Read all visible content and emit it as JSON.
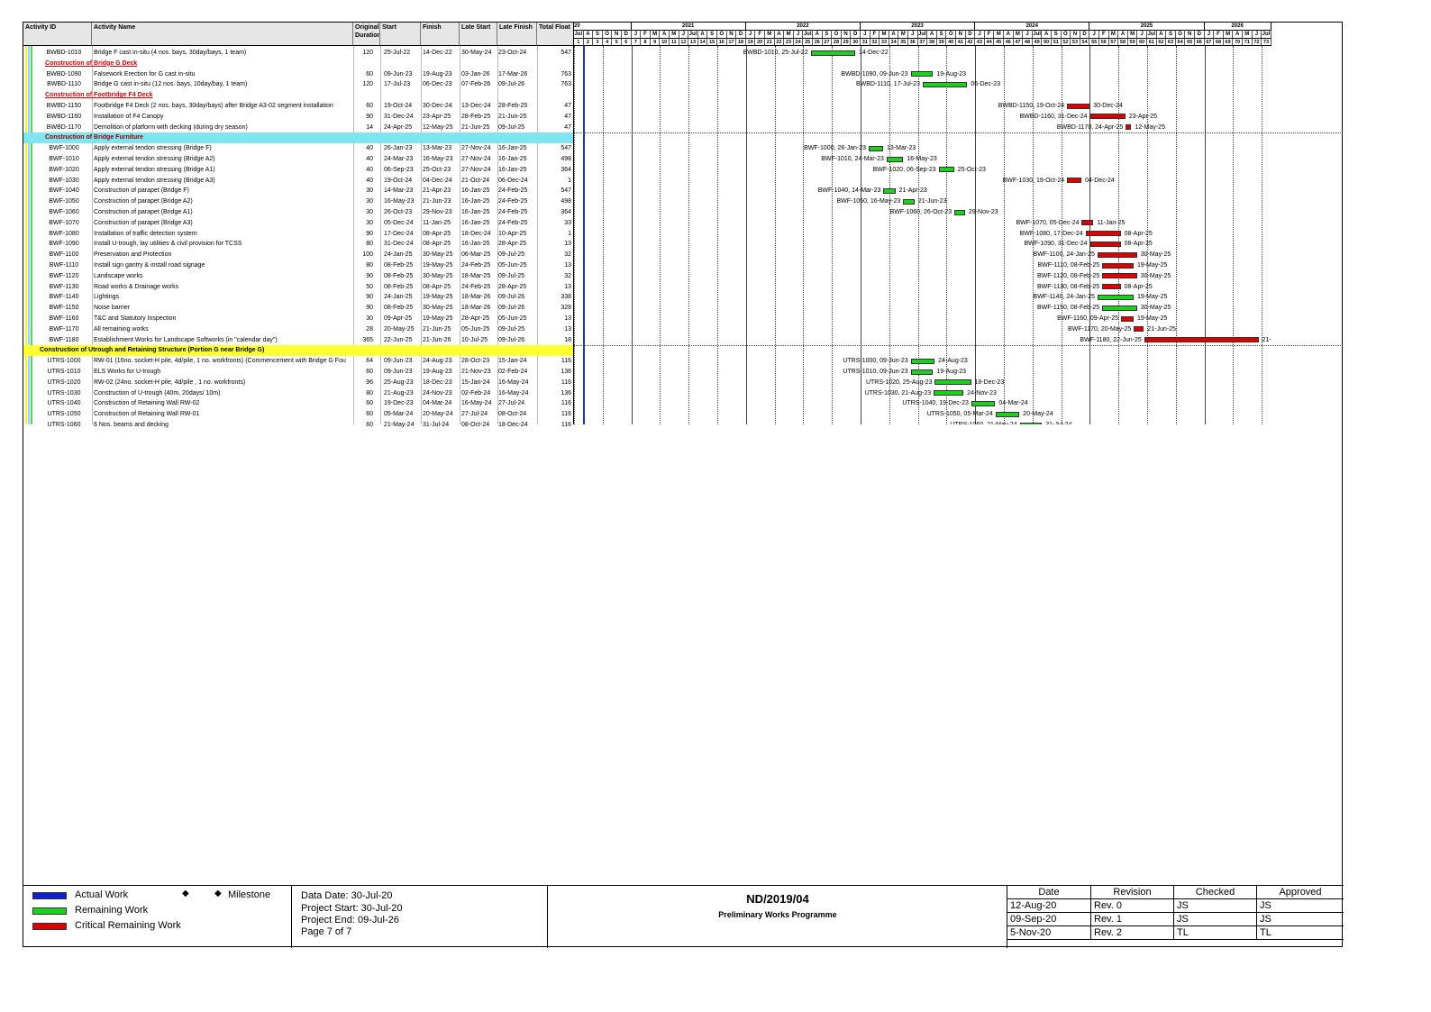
{
  "columns": {
    "id": "Activity ID",
    "name": "Activity Name",
    "duration": "Original Duration",
    "start": "Start",
    "finish": "Finish",
    "late_start": "Late Start",
    "late_finish": "Late Finish",
    "total_float": "Total Float"
  },
  "rows": [
    {
      "type": "act",
      "id": "BWBD-1010",
      "name": "Bridge F cast in-situ (4 nos. bays, 30day/bays, 1 team)",
      "dur": "120",
      "start": "25-Jul-22",
      "finish": "14-Dec-22",
      "ls": "30-May-24",
      "lf": "23-Oct-24",
      "tf": "547",
      "crit": false,
      "bar_label": "BWBD-1010, 25-Jul-22"
    },
    {
      "type": "wbs",
      "style": "red",
      "name": "Construction of Bridge G Deck"
    },
    {
      "type": "act",
      "id": "BWBD-1090",
      "name": "Falsework Erection for G cast in-situ",
      "dur": "60",
      "start": "09-Jun-23",
      "finish": "19-Aug-23",
      "ls": "03-Jan-26",
      "lf": "17-Mar-26",
      "tf": "763",
      "crit": false,
      "bar_label": "BWBD-1090, 09-Jun-23"
    },
    {
      "type": "act",
      "id": "BWBD-1110",
      "name": "Bridge G cast in-situ (12 nos. bays, 10day/bay, 1 team)",
      "dur": "120",
      "start": "17-Jul-23",
      "finish": "06-Dec-23",
      "ls": "07-Feb-26",
      "lf": "09-Jul-26",
      "tf": "763",
      "crit": false,
      "bar_label": "BWBD-1110, 17-Jul-23"
    },
    {
      "type": "wbs",
      "style": "red",
      "name": "Construction of Footbridge F4 Deck"
    },
    {
      "type": "act",
      "id": "BWBD-1150",
      "name": "Footbridge F4 Deck (2 nos. bays, 30day/bays) after Bridge A3-02 segment installation",
      "dur": "60",
      "start": "19-Oct-24",
      "finish": "30-Dec-24",
      "ls": "13-Dec-24",
      "lf": "28-Feb-25",
      "tf": "47",
      "crit": true,
      "bar_label": "BWBD-1150, 19-Oct-24"
    },
    {
      "type": "act",
      "id": "BWBD-1160",
      "name": "Installation of F4 Canopy",
      "dur": "90",
      "start": "31-Dec-24",
      "finish": "23-Apr-25",
      "ls": "28-Feb-25",
      "lf": "21-Jun-25",
      "tf": "47",
      "crit": true,
      "bar_label": "BWBD-1160, 31-Dec-24"
    },
    {
      "type": "act",
      "id": "BWBD-1170",
      "name": "Demolition of platform with decking (during dry season)",
      "dur": "14",
      "start": "24-Apr-25",
      "finish": "12-May-25",
      "ls": "21-Jun-25",
      "lf": "09-Jul-25",
      "tf": "47",
      "crit": true,
      "bar_label": "BWBD-1170, 24-Apr-25"
    },
    {
      "type": "wbs",
      "style": "cyan",
      "name": "Construction of Bridge Furniture"
    },
    {
      "type": "act",
      "id": "BWF-1000",
      "name": "Apply external tendon stressing (Bridge F)",
      "dur": "40",
      "start": "26-Jan-23",
      "finish": "13-Mar-23",
      "ls": "27-Nov-24",
      "lf": "16-Jan-25",
      "tf": "547",
      "crit": false,
      "bar_label": "BWF-1000, 26-Jan-23"
    },
    {
      "type": "act",
      "id": "BWF-1010",
      "name": "Apply external tendon stressing (Bridge A2)",
      "dur": "40",
      "start": "24-Mar-23",
      "finish": "16-May-23",
      "ls": "27-Nov-24",
      "lf": "16-Jan-25",
      "tf": "498",
      "crit": false,
      "bar_label": "BWF-1010, 24-Mar-23"
    },
    {
      "type": "act",
      "id": "BWF-1020",
      "name": "Apply external tendon stressing (Bridge A1)",
      "dur": "40",
      "start": "06-Sep-23",
      "finish": "25-Oct-23",
      "ls": "27-Nov-24",
      "lf": "16-Jan-25",
      "tf": "364",
      "crit": false,
      "bar_label": "BWF-1020, 06-Sep-23"
    },
    {
      "type": "act",
      "id": "BWF-1030",
      "name": "Apply external tendon stressing (Bridge A3)",
      "dur": "40",
      "start": "19-Oct-24",
      "finish": "04-Dec-24",
      "ls": "21-Oct-24",
      "lf": "06-Dec-24",
      "tf": "1",
      "crit": true,
      "bar_label": "BWF-1030, 19-Oct-24"
    },
    {
      "type": "act",
      "id": "BWF-1040",
      "name": "Construction of parapet  (Bridge F)",
      "dur": "30",
      "start": "14-Mar-23",
      "finish": "21-Apr-23",
      "ls": "16-Jan-25",
      "lf": "24-Feb-25",
      "tf": "547",
      "crit": false,
      "bar_label": "BWF-1040, 14-Mar-23"
    },
    {
      "type": "act",
      "id": "BWF-1050",
      "name": "Construction of parapet (Bridge A2)",
      "dur": "30",
      "start": "16-May-23",
      "finish": "21-Jun-23",
      "ls": "16-Jan-25",
      "lf": "24-Feb-25",
      "tf": "498",
      "crit": false,
      "bar_label": "BWF-1050, 16-May-23"
    },
    {
      "type": "act",
      "id": "BWF-1060",
      "name": "Construction of parapet (Bridge A1)",
      "dur": "30",
      "start": "26-Oct-23",
      "finish": "29-Nov-23",
      "ls": "16-Jan-25",
      "lf": "24-Feb-25",
      "tf": "364",
      "crit": false,
      "bar_label": "BWF-1060, 26-Oct-23"
    },
    {
      "type": "act",
      "id": "BWF-1070",
      "name": "Construction of parapet (Bridge A3)",
      "dur": "30",
      "start": "05-Dec-24",
      "finish": "11-Jan-25",
      "ls": "16-Jan-25",
      "lf": "24-Feb-25",
      "tf": "33",
      "crit": true,
      "bar_label": "BWF-1070, 05-Dec-24"
    },
    {
      "type": "act",
      "id": "BWF-1080",
      "name": "Installation of traffic detection system",
      "dur": "90",
      "start": "17-Dec-24",
      "finish": "08-Apr-25",
      "ls": "18-Dec-24",
      "lf": "10-Apr-25",
      "tf": "1",
      "crit": true,
      "bar_label": "BWF-1080, 17-Dec-24"
    },
    {
      "type": "act",
      "id": "BWF-1090",
      "name": "Install U-trough, lay utilities & civil provision for TCSS",
      "dur": "80",
      "start": "31-Dec-24",
      "finish": "08-Apr-25",
      "ls": "16-Jan-25",
      "lf": "28-Apr-25",
      "tf": "13",
      "crit": true,
      "bar_label": "BWF-1090, 31-Dec-24"
    },
    {
      "type": "act",
      "id": "BWF-1100",
      "name": "Preservation and Protection",
      "dur": "100",
      "start": "24-Jan-25",
      "finish": "30-May-25",
      "ls": "06-Mar-25",
      "lf": "09-Jul-25",
      "tf": "32",
      "crit": true,
      "bar_label": "BWF-1100, 24-Jan-25"
    },
    {
      "type": "act",
      "id": "BWF-1110",
      "name": "Install sign gantry & install road signage",
      "dur": "80",
      "start": "08-Feb-25",
      "finish": "19-May-25",
      "ls": "24-Feb-25",
      "lf": "05-Jun-25",
      "tf": "13",
      "crit": true,
      "bar_label": "BWF-1110, 08-Feb-25"
    },
    {
      "type": "act",
      "id": "BWF-1120",
      "name": "Landscape works",
      "dur": "90",
      "start": "08-Feb-25",
      "finish": "30-May-25",
      "ls": "18-Mar-25",
      "lf": "09-Jul-25",
      "tf": "32",
      "crit": true,
      "bar_label": "BWF-1120, 08-Feb-25"
    },
    {
      "type": "act",
      "id": "BWF-1130",
      "name": "Road works & Drainage works",
      "dur": "50",
      "start": "08-Feb-25",
      "finish": "08-Apr-25",
      "ls": "24-Feb-25",
      "lf": "28-Apr-25",
      "tf": "13",
      "crit": true,
      "bar_label": "BWF-1130, 08-Feb-25"
    },
    {
      "type": "act",
      "id": "BWF-1140",
      "name": "Lightings",
      "dur": "90",
      "start": "24-Jan-25",
      "finish": "19-May-25",
      "ls": "18-Mar-26",
      "lf": "09-Jul-26",
      "tf": "338",
      "crit": false,
      "bar_label": "BWF-1140, 24-Jan-25"
    },
    {
      "type": "act",
      "id": "BWF-1150",
      "name": "Noise barrier",
      "dur": "90",
      "start": "08-Feb-25",
      "finish": "30-May-25",
      "ls": "18-Mar-26",
      "lf": "09-Jul-26",
      "tf": "328",
      "crit": false,
      "bar_label": "BWF-1150, 08-Feb-25"
    },
    {
      "type": "act",
      "id": "BWF-1160",
      "name": "T&C and Statutory Inspection",
      "dur": "30",
      "start": "09-Apr-25",
      "finish": "19-May-25",
      "ls": "28-Apr-25",
      "lf": "05-Jun-25",
      "tf": "13",
      "crit": true,
      "bar_label": "BWF-1160, 09-Apr-25"
    },
    {
      "type": "act",
      "id": "BWF-1170",
      "name": "All remaining works",
      "dur": "28",
      "start": "20-May-25",
      "finish": "21-Jun-25",
      "ls": "05-Jun-25",
      "lf": "09-Jul-25",
      "tf": "13",
      "crit": true,
      "bar_label": "BWF-1170, 20-May-25"
    },
    {
      "type": "act",
      "id": "BWF-1180",
      "name": "Establishment Works for Landscape Softworks (in \"calendar day\")",
      "dur": "365",
      "start": "22-Jun-25",
      "finish": "21-Jun-26",
      "ls": "10-Jul-25",
      "lf": "09-Jul-26",
      "tf": "18",
      "crit": true,
      "bar_label": "BWF-1180, 22-Jun-25",
      "finish_label": "21-"
    },
    {
      "type": "wbs",
      "style": "yellow",
      "name": "Construction of Utrough and Retaining Structure (Portion G near Bridge G)"
    },
    {
      "type": "act",
      "id": "UTRS-1000",
      "name": "RW-01 (16no. socket-H pile, 4d/pile, 1 no. workfronts) (Commencement with Bridge G Fou",
      "dur": "64",
      "start": "09-Jun-23",
      "finish": "24-Aug-23",
      "ls": "28-Oct-23",
      "lf": "15-Jan-24",
      "tf": "116",
      "crit": false,
      "bar_label": "UTRS-1000, 09-Jun-23"
    },
    {
      "type": "act",
      "id": "UTRS-1010",
      "name": "ELS Works for U-trough",
      "dur": "60",
      "start": "09-Jun-23",
      "finish": "19-Aug-23",
      "ls": "21-Nov-23",
      "lf": "02-Feb-24",
      "tf": "136",
      "crit": false,
      "bar_label": "UTRS-1010, 09-Jun-23"
    },
    {
      "type": "act",
      "id": "UTRS-1020",
      "name": "RW-02 (24no.  socket-H pile, 4d/pile , 1 no. workfronts)",
      "dur": "96",
      "start": "25-Aug-23",
      "finish": "18-Dec-23",
      "ls": "15-Jan-24",
      "lf": "16-May-24",
      "tf": "116",
      "crit": false,
      "bar_label": "UTRS-1020, 25-Aug-23"
    },
    {
      "type": "act",
      "id": "UTRS-1030",
      "name": "Construction of U-trough (40m, 20days/ 10m)",
      "dur": "80",
      "start": "21-Aug-23",
      "finish": "24-Nov-23",
      "ls": "02-Feb-24",
      "lf": "16-May-24",
      "tf": "136",
      "crit": false,
      "bar_label": "UTRS-1030, 21-Aug-23"
    },
    {
      "type": "act",
      "id": "UTRS-1040",
      "name": "Construction of Retaining Wall RW-02",
      "dur": "60",
      "start": "19-Dec-23",
      "finish": "04-Mar-24",
      "ls": "16-May-24",
      "lf": "27-Jul-24",
      "tf": "116",
      "crit": false,
      "bar_label": "UTRS-1040, 19-Dec-23"
    },
    {
      "type": "act",
      "id": "UTRS-1050",
      "name": "Construction of Retaining Wall RW-01",
      "dur": "60",
      "start": "05-Mar-24",
      "finish": "20-May-24",
      "ls": "27-Jul-24",
      "lf": "08-Oct-24",
      "tf": "116",
      "crit": false,
      "bar_label": "UTRS-1050, 05-Mar-24"
    },
    {
      "type": "act",
      "id": "UTRS-1060",
      "name": "6 Nos. beams and decking",
      "dur": "60",
      "start": "21-May-24",
      "finish": "31-Jul-24",
      "ls": "08-Oct-24",
      "lf": "18-Dec-24",
      "tf": "116",
      "crit": false,
      "bar_label": "UTRS-1060, 21-May-24"
    }
  ],
  "timeline": {
    "years": [
      "20",
      "2021",
      "2022",
      "2023",
      "2024",
      "2025",
      "2026"
    ],
    "months": [
      "Jul",
      "A",
      "S",
      "O",
      "N",
      "D",
      "J",
      "F",
      "M",
      "A",
      "M",
      "J",
      "Jul",
      "A",
      "S",
      "O",
      "N",
      "D",
      "J",
      "F",
      "M",
      "A",
      "M",
      "J",
      "Jul",
      "A",
      "S",
      "O",
      "N",
      "D",
      "J",
      "F",
      "M",
      "A",
      "M",
      "J",
      "Jul",
      "A",
      "S",
      "O",
      "N",
      "D",
      "J",
      "F",
      "M",
      "A",
      "M",
      "J",
      "Jul",
      "A",
      "S",
      "O",
      "N",
      "D",
      "J",
      "F",
      "M",
      "A",
      "M",
      "J",
      "Jul",
      "A",
      "S",
      "O",
      "N",
      "D",
      "J",
      "F",
      "M",
      "A",
      "M",
      "J",
      "Jul"
    ],
    "numbers": [
      "1",
      "2",
      "3",
      "4",
      "5",
      "6",
      "7",
      "8",
      "9",
      "10",
      "11",
      "12",
      "13",
      "14",
      "15",
      "16",
      "17",
      "18",
      "19",
      "20",
      "21",
      "22",
      "23",
      "24",
      "25",
      "26",
      "27",
      "28",
      "29",
      "30",
      "31",
      "32",
      "33",
      "34",
      "35",
      "36",
      "37",
      "38",
      "39",
      "40",
      "41",
      "42",
      "43",
      "44",
      "45",
      "46",
      "47",
      "48",
      "49",
      "50",
      "51",
      "52",
      "53",
      "54",
      "55",
      "56",
      "57",
      "58",
      "59",
      "60",
      "61",
      "62",
      "63",
      "64",
      "65",
      "66",
      "67",
      "68",
      "69",
      "70",
      "71",
      "72",
      "73"
    ]
  },
  "colors": {
    "actual": "#0b1fd6",
    "remaining": "#1fd11f",
    "critical": "#e00000"
  },
  "legend": {
    "actual": "Actual Work",
    "remaining": "Remaining Work",
    "critical": "Critical Remaining Work",
    "milestone": "Milestone"
  },
  "info": {
    "data_date": "Data Date: 30-Jul-20",
    "project_start": "Project Start: 30-Jul-20",
    "project_end": "Project End: 09-Jul-26",
    "page": "Page 7 of 7"
  },
  "title": {
    "code": "ND/2019/04",
    "subtitle": "Preliminary Works Programme"
  },
  "revisions": {
    "headers": [
      "Date",
      "Revision",
      "Checked",
      "Approved"
    ],
    "rows": [
      [
        "12-Aug-20",
        "Rev. 0",
        "JS",
        "JS"
      ],
      [
        "09-Sep-20",
        "Rev. 1",
        "JS",
        "JS"
      ],
      [
        "5-Nov-20",
        "Rev. 2",
        "TL",
        "TL"
      ]
    ]
  }
}
